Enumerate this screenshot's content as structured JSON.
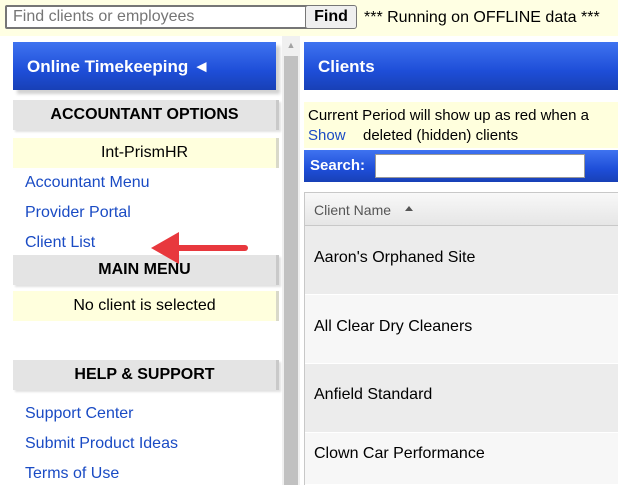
{
  "topbar": {
    "search_placeholder": "Find clients or employees",
    "find_label": "Find",
    "status_text": "*** Running on OFFLINE data ***"
  },
  "sidebar": {
    "title": "Online Timekeeping ◄",
    "accountant_options_title": "ACCOUNTANT OPTIONS",
    "current_provider": "Int-PrismHR",
    "accountant_links": [
      "Accountant Menu",
      "Provider Portal",
      "Client List"
    ],
    "main_menu_title": "MAIN MENU",
    "no_client_text": "No client is selected",
    "help_title": "HELP & SUPPORT",
    "help_links": [
      "Support Center",
      "Submit Product Ideas",
      "Terms of Use"
    ],
    "arrow_color": "#e8383d",
    "accent_color": "#1e4ed8"
  },
  "clients": {
    "title": "Clients",
    "period_text": "Current Period will show up as red when a",
    "show_link": "Show",
    "deleted_text": "deleted (hidden) clients",
    "search_label": "Search:",
    "search_value": "",
    "column_header": "Client Name",
    "rows": [
      "Aaron's Orphaned Site",
      "All Clear Dry Cleaners",
      "Anfield Standard",
      "Clown Car Performance"
    ]
  }
}
